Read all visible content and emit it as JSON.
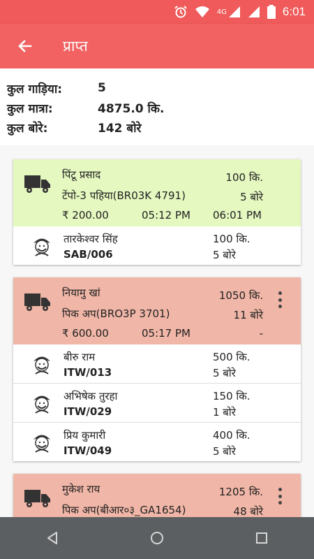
{
  "status_bar": {
    "time": "6:01",
    "network": "4G",
    "icons": [
      "alarm-icon",
      "wifi-icon",
      "signal-icon",
      "battery-icon"
    ]
  },
  "app_bar": {
    "title": "प्राप्त",
    "back_icon": "arrow-left-icon"
  },
  "summary": {
    "vehicles_label": "कुल गाड़िया:",
    "vehicles_value": "5",
    "quantity_label": "कुल मात्रा:",
    "quantity_value": "4875.0 कि.",
    "bags_label": "कुल बोरे:",
    "bags_value": "142 बोरे"
  },
  "trips": [
    {
      "driver": "पिंटू प्रसाद",
      "vehicle": "टेंपो-3 पहिया(BR03K 4791)",
      "weight": "100 कि.",
      "bags": "5 बोरे",
      "amount": "₹ 200.00",
      "time_start": "05:12 PM",
      "time_end": "06:01 PM",
      "color": "#e5f8c0",
      "farmers": [
        {
          "name": "तारकेश्वर सिंह",
          "code": "SAB/006",
          "weight": "100 कि.",
          "bags": "5 बोरे"
        }
      ]
    },
    {
      "driver": "नियामु खां",
      "vehicle": "पिक अप(BRO3P 3701)",
      "weight": "1050 कि.",
      "bags": "11 बोरे",
      "amount": "₹ 600.00",
      "time_start": "05:17 PM",
      "time_end": "-",
      "color": "#f0b6a7",
      "farmers": [
        {
          "name": "बीरु राम",
          "code": "ITW/013",
          "weight": "500 कि.",
          "bags": "5 बोरे"
        },
        {
          "name": "अभिषेक तुरहा",
          "code": "ITW/029",
          "weight": "150 कि.",
          "bags": "1 बोरे"
        },
        {
          "name": "प्रिय कुमारी",
          "code": "ITW/049",
          "weight": "400 कि.",
          "bags": "5 बोरे"
        }
      ]
    },
    {
      "driver": "मुकेश राय",
      "vehicle": "पिक अप(बीआर०३_GA1654)",
      "weight": "1205 कि.",
      "bags": "48 बोरे",
      "color": "#f0b6a7"
    }
  ],
  "nav": {
    "back": "triangle-back-icon",
    "home": "circle-home-icon",
    "recents": "square-recents-icon"
  }
}
